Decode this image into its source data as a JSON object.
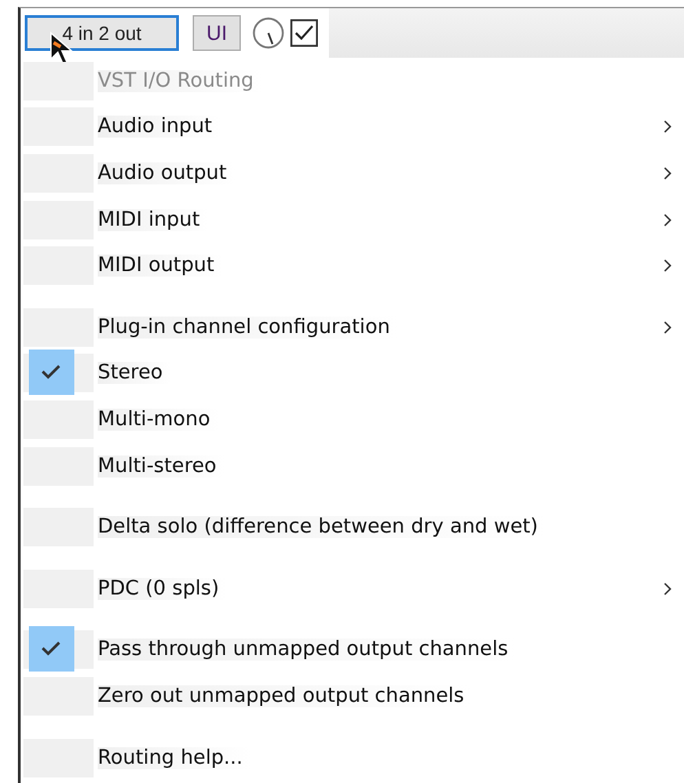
{
  "toolbar": {
    "io_button": "4 in 2 out",
    "ui_button": "UI",
    "bypass_checked": true
  },
  "menu": [
    {
      "kind": "item",
      "label": "VST I/O Routing",
      "disabled": true,
      "checked": false,
      "submenu": false
    },
    {
      "kind": "item",
      "label": "Audio input",
      "disabled": false,
      "checked": false,
      "submenu": true
    },
    {
      "kind": "item",
      "label": "Audio output",
      "disabled": false,
      "checked": false,
      "submenu": true
    },
    {
      "kind": "item",
      "label": "MIDI input",
      "disabled": false,
      "checked": false,
      "submenu": true
    },
    {
      "kind": "item",
      "label": "MIDI output",
      "disabled": false,
      "checked": false,
      "submenu": true
    },
    {
      "kind": "separator"
    },
    {
      "kind": "item",
      "label": "Plug-in channel configuration",
      "disabled": false,
      "checked": false,
      "submenu": true
    },
    {
      "kind": "item",
      "label": "Stereo",
      "disabled": false,
      "checked": true,
      "submenu": false
    },
    {
      "kind": "item",
      "label": "Multi-mono",
      "disabled": false,
      "checked": false,
      "submenu": false
    },
    {
      "kind": "item",
      "label": "Multi-stereo",
      "disabled": false,
      "checked": false,
      "submenu": false
    },
    {
      "kind": "separator"
    },
    {
      "kind": "item",
      "label": "Delta solo (difference between dry and wet)",
      "disabled": false,
      "checked": false,
      "submenu": false
    },
    {
      "kind": "separator"
    },
    {
      "kind": "item",
      "label": "PDC (0 spls)",
      "disabled": false,
      "checked": false,
      "submenu": true
    },
    {
      "kind": "separator"
    },
    {
      "kind": "item",
      "label": "Pass through unmapped output channels",
      "disabled": false,
      "checked": true,
      "submenu": false
    },
    {
      "kind": "item",
      "label": "Zero out unmapped output channels",
      "disabled": false,
      "checked": false,
      "submenu": false
    },
    {
      "kind": "separator"
    },
    {
      "kind": "item",
      "label": "Routing help...",
      "disabled": false,
      "checked": false,
      "submenu": false
    }
  ]
}
